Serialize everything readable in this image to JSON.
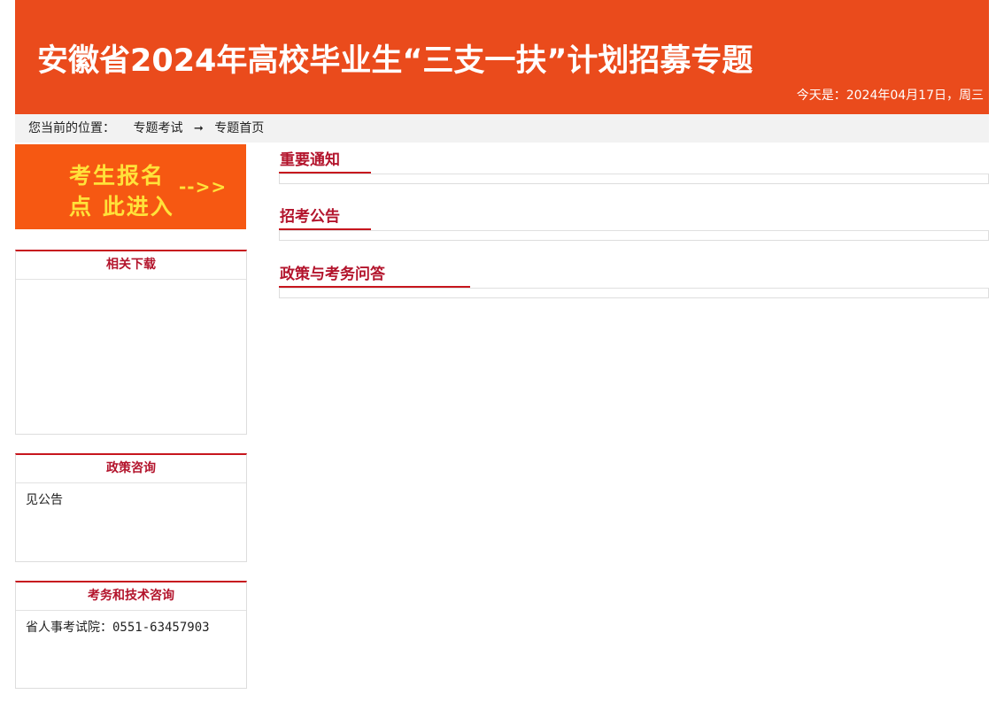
{
  "header": {
    "title": "安徽省2024年高校毕业生“三支一扶”计划招募专题",
    "date_text": "今天是：2024年04月17日，周三"
  },
  "breadcrumb": {
    "prefix": "您当前的位置：",
    "item1": "专题考试",
    "arrow": "➞",
    "item2": "专题首页"
  },
  "signup": {
    "line1": "考生报名",
    "line2": "点 此进入",
    "arrow": "-->>"
  },
  "sidebar": {
    "downloads": {
      "title": "相关下载"
    },
    "policy": {
      "title": "政策咨询",
      "text": "见公告"
    },
    "support": {
      "title": "考务和技术咨询",
      "text": "省人事考试院：0551-63457903"
    }
  },
  "sections": [
    {
      "title": "重要通知"
    },
    {
      "title": "招考公告"
    },
    {
      "title": "政策与考务问答"
    }
  ],
  "colors": {
    "header_bg": "#ea4b1c",
    "accent_red": "#c7161e",
    "title_red": "#b3142c",
    "signup_bg": "#f65812",
    "signup_text": "#ffe23a"
  }
}
